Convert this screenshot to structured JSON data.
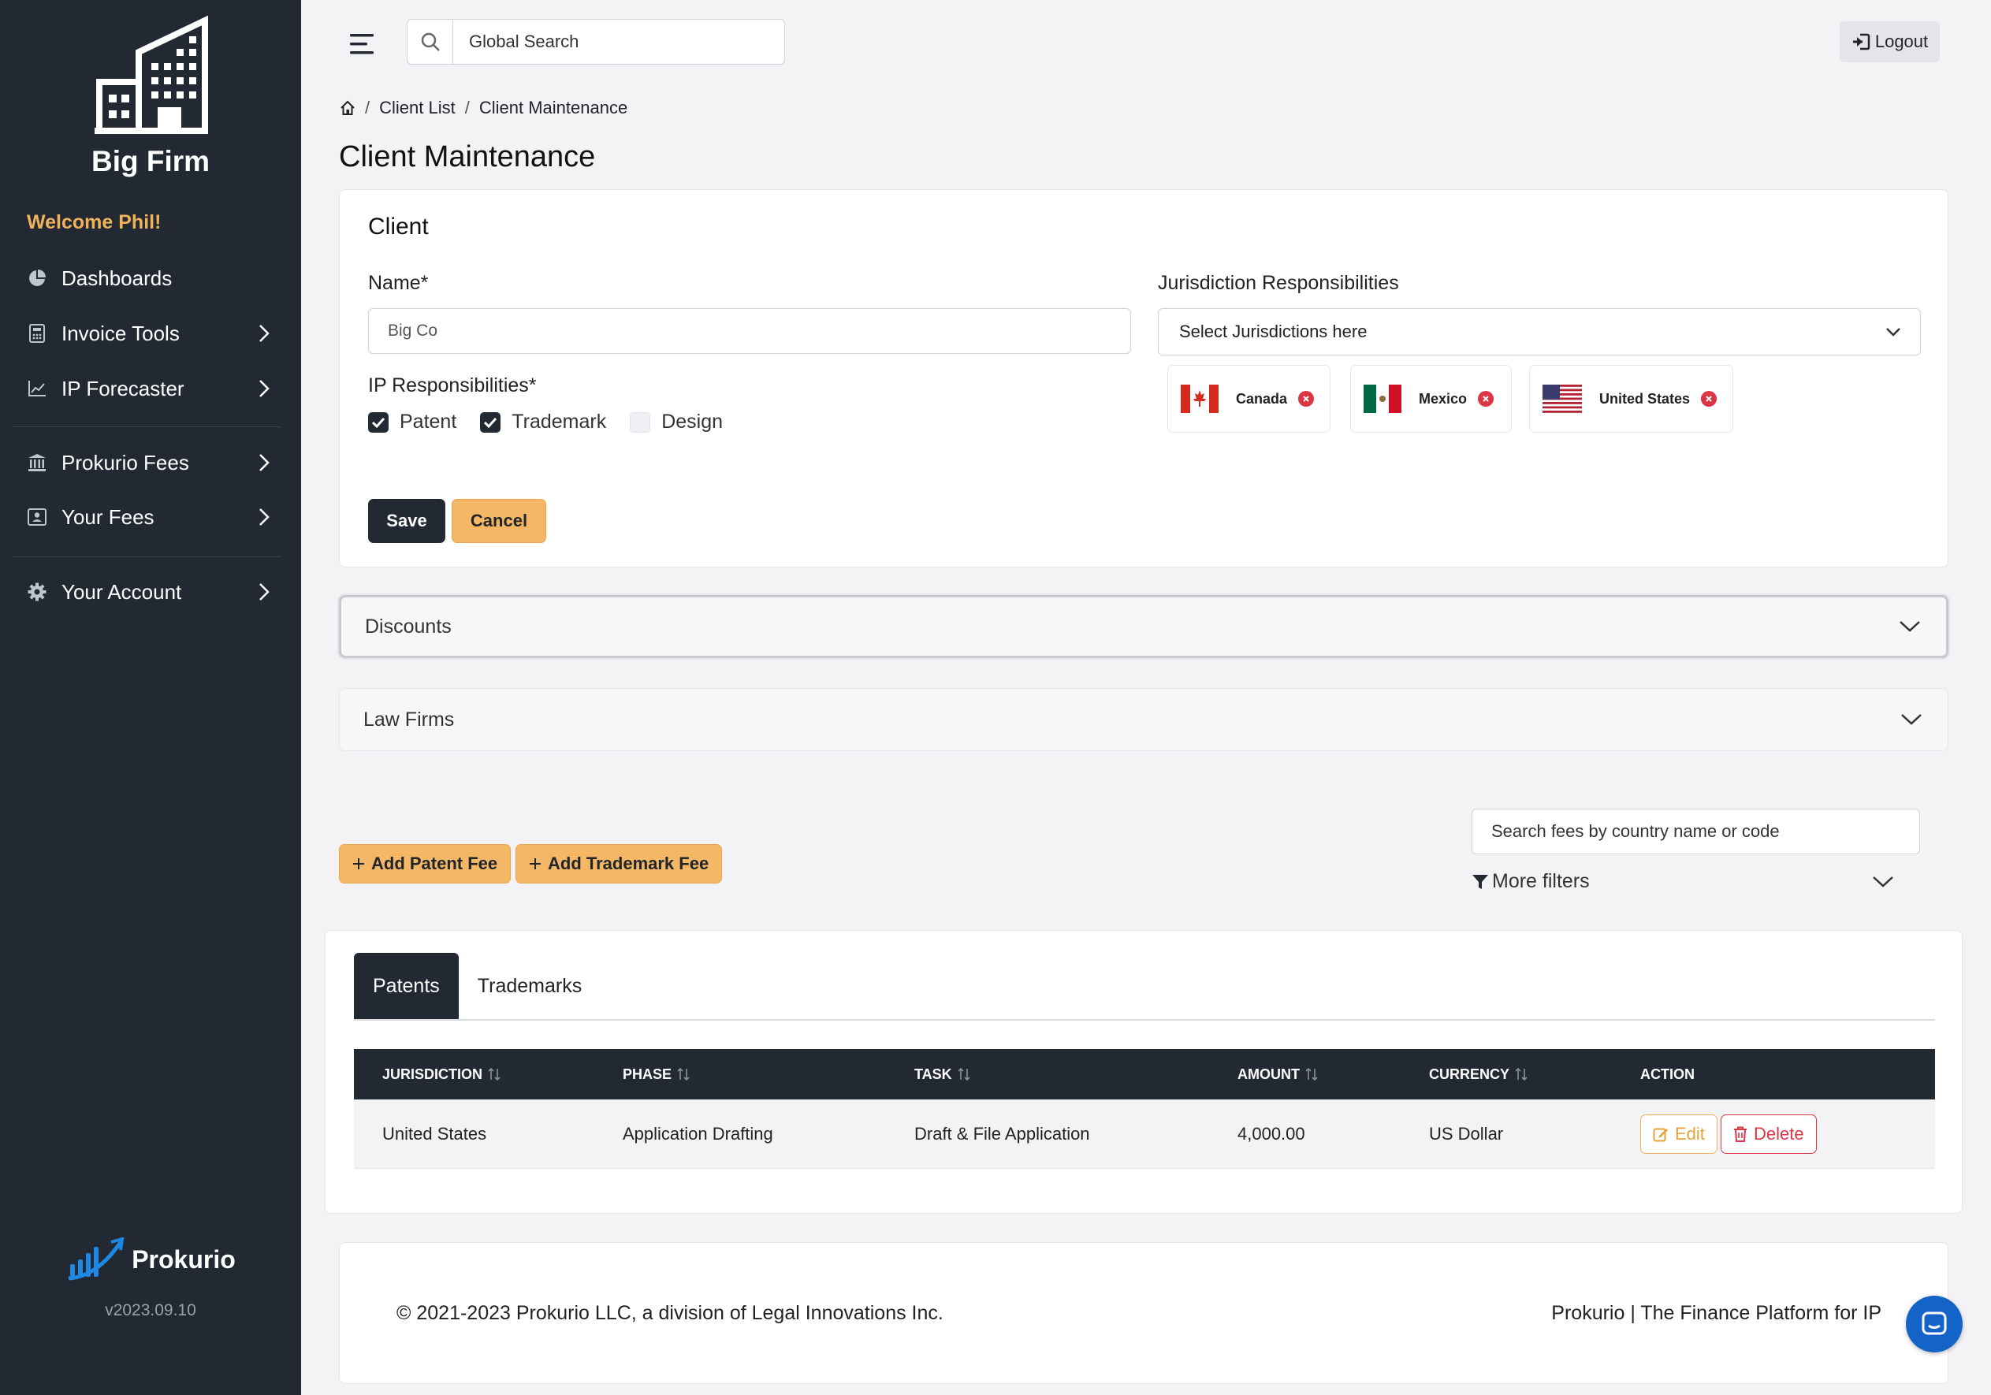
{
  "sidebar": {
    "brand": "Big Firm",
    "welcome": "Welcome Phil!",
    "items": [
      {
        "label": "Dashboards",
        "icon": "pie-chart-icon"
      },
      {
        "label": "Invoice Tools",
        "icon": "calculator-icon"
      },
      {
        "label": "IP Forecaster",
        "icon": "line-chart-icon"
      },
      {
        "label": "Prokurio Fees",
        "icon": "bank-icon"
      },
      {
        "label": "Your Fees",
        "icon": "person-badge-icon"
      },
      {
        "label": "Your Account",
        "icon": "gear-icon"
      }
    ],
    "footer_brand": "Prokurio",
    "version": "v2023.09.10"
  },
  "topbar": {
    "search_placeholder": "Global Search",
    "logout_label": "Logout"
  },
  "breadcrumb": {
    "items": [
      "Client List",
      "Client Maintenance"
    ],
    "sep": "/"
  },
  "page_title": "Client Maintenance",
  "client": {
    "title": "Client",
    "name_label": "Name*",
    "name_value": "Big Co",
    "ip_label": "IP Responsibilities*",
    "ip_options": [
      {
        "label": "Patent",
        "checked": true
      },
      {
        "label": "Trademark",
        "checked": true
      },
      {
        "label": "Design",
        "checked": false
      }
    ],
    "jurisdiction_label": "Jurisdiction Responsibilities",
    "jurisdiction_placeholder": "Select Jurisdictions here",
    "jurisdictions": [
      "Canada",
      "Mexico",
      "United States"
    ],
    "save_label": "Save",
    "cancel_label": "Cancel"
  },
  "accordions": [
    "Discounts",
    "Law Firms"
  ],
  "fees": {
    "add_patent_label": "Add Patent Fee",
    "add_trademark_label": "Add Trademark Fee",
    "search_placeholder": "Search fees by country name or code",
    "more_filters_label": "More filters"
  },
  "tabs": [
    "Patents",
    "Trademarks"
  ],
  "table": {
    "columns": [
      "JURISDICTION",
      "PHASE",
      "TASK",
      "AMOUNT",
      "CURRENCY",
      "ACTION"
    ],
    "rows": [
      {
        "jurisdiction": "United States",
        "phase": "Application Drafting",
        "task": "Draft & File Application",
        "amount": "4,000.00",
        "currency": "US Dollar"
      }
    ],
    "edit_label": "Edit",
    "delete_label": "Delete"
  },
  "footer": {
    "copyright": "© 2021-2023 Prokurio LLC, a division of Legal Innovations Inc.",
    "tagline": "Prokurio | The Finance Platform for IP"
  },
  "colors": {
    "sidebar_bg": "#232933",
    "accent_amber": "#f3b766",
    "danger": "#dc3545",
    "brand_blue": "#1e88e5"
  }
}
